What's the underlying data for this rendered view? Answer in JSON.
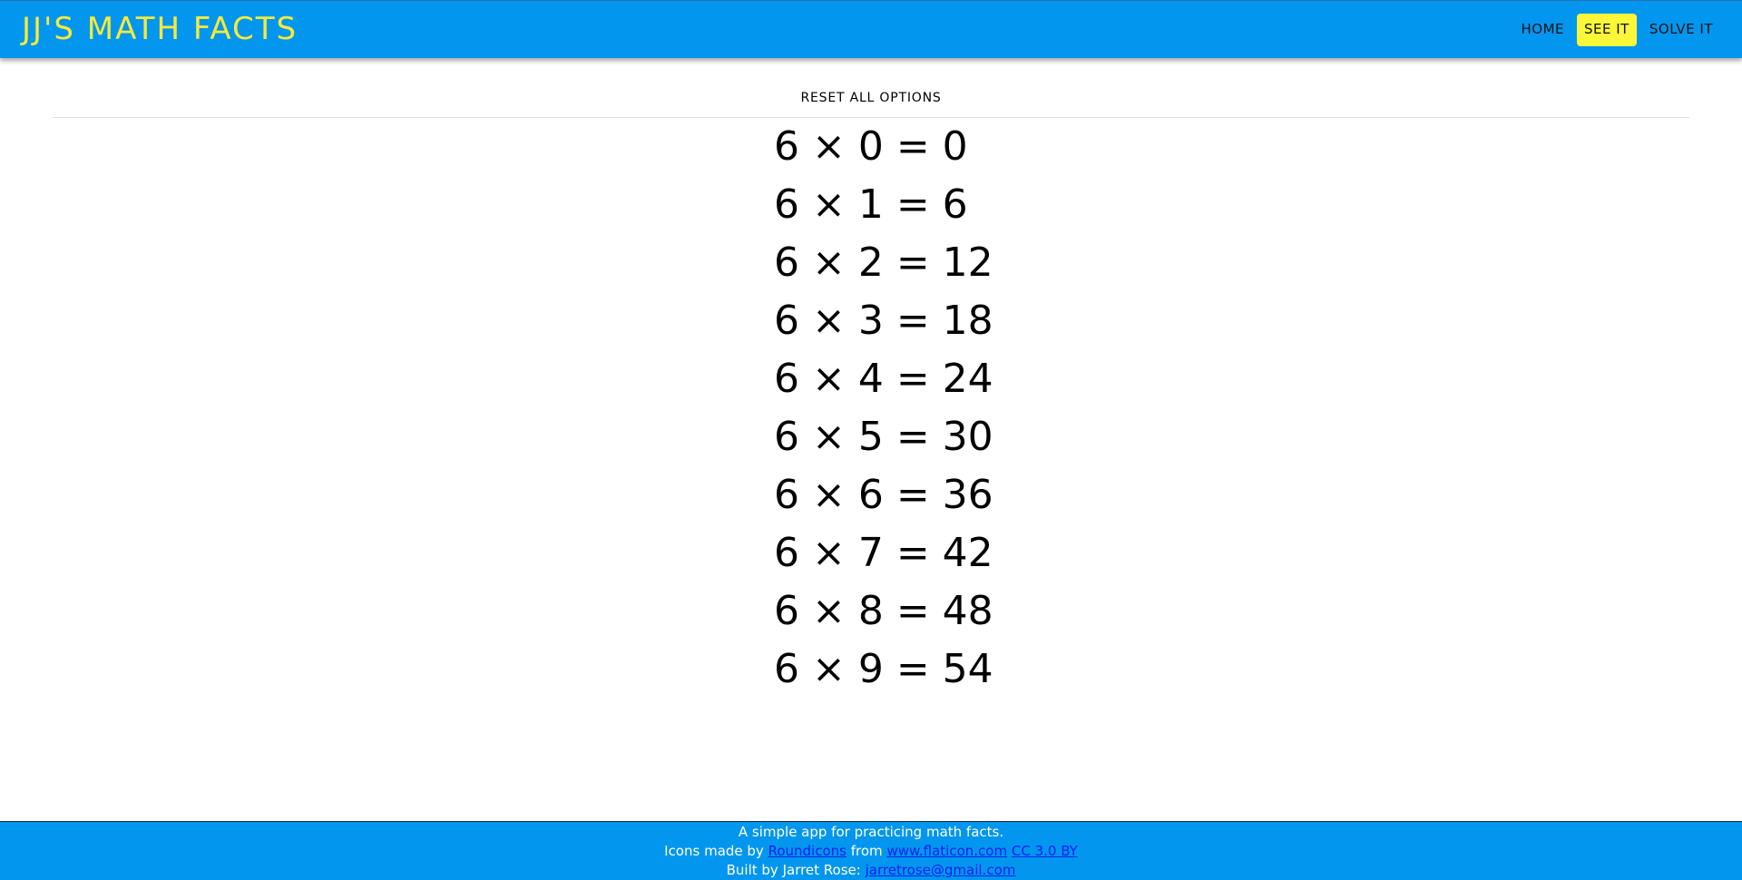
{
  "header": {
    "brand": "JJ'S MATH FACTS",
    "nav": [
      {
        "label": "HOME",
        "active": false
      },
      {
        "label": "SEE IT",
        "active": true
      },
      {
        "label": "SOLVE IT",
        "active": false
      }
    ],
    "colors": {
      "background": "#0396ee",
      "brand": "#f6ea3a",
      "active_tab": "#fbf638"
    }
  },
  "main": {
    "reset_label": "RESET ALL OPTIONS",
    "facts": [
      "6 × 0 = 0",
      "6 × 1 = 6",
      "6 × 2 = 12",
      "6 × 3 = 18",
      "6 × 4 = 24",
      "6 × 5 = 30",
      "6 × 6 = 36",
      "6 × 7 = 42",
      "6 × 8 = 48",
      "6 × 9 = 54"
    ]
  },
  "footer": {
    "line1": "A simple app for practicing math facts.",
    "line2_prefix": "Icons made by",
    "line2_author": "Roundicons",
    "line2_from": "from",
    "line2_site": "www.flaticon.com",
    "line2_license": "CC 3.0 BY",
    "line3_prefix": "Built by Jarret Rose:",
    "line3_email": "jarretrose@gmail.com"
  }
}
